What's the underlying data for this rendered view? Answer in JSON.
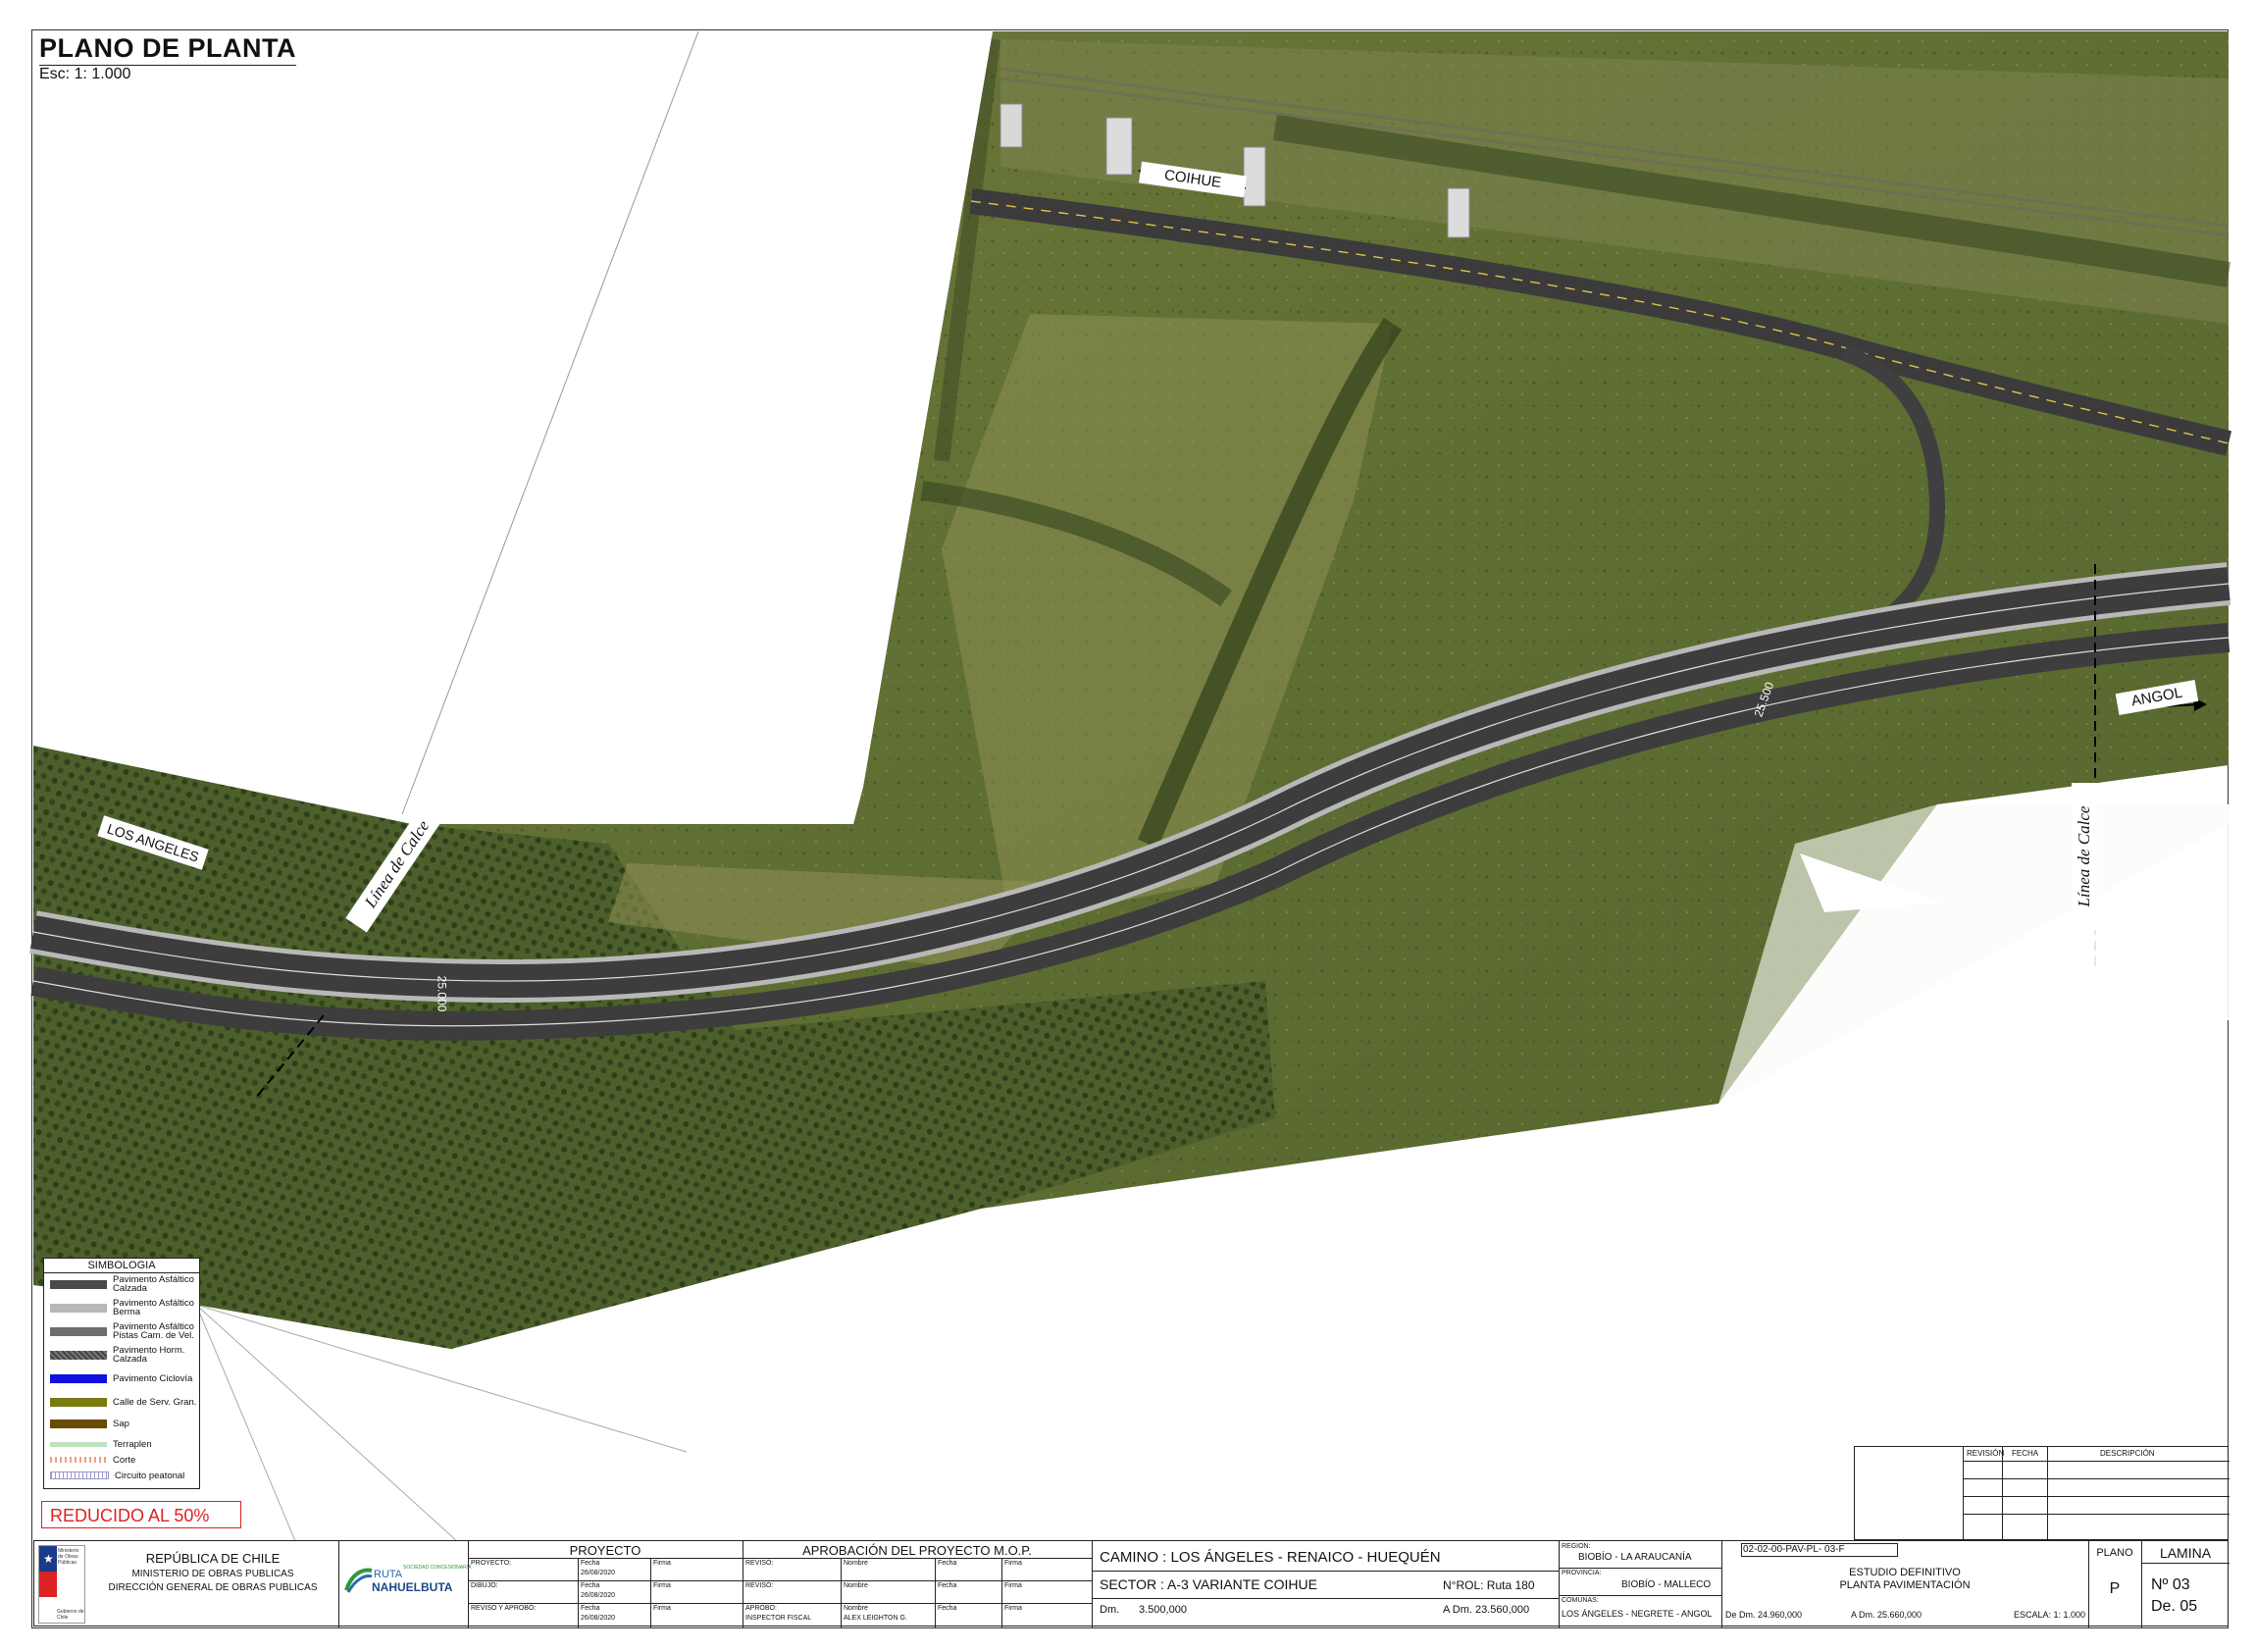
{
  "sheet": {
    "title": "PLANO DE PLANTA",
    "scale": "Esc: 1: 1.000",
    "reduced_note": "REDUCIDO AL 50%"
  },
  "map": {
    "labels": {
      "coihue": "COIHUE",
      "los_angeles": "LOS ANGELES",
      "angol": "ANGOL",
      "linea_calce_left": "Línea de Calce",
      "linea_calce_right": "Línea de Calce",
      "station_top": "25.500",
      "station_bottom": "25.000"
    }
  },
  "legend": {
    "header": "SIMBOLOGIA",
    "items": [
      {
        "label": "Pavimento Asfáltico Calzada",
        "color": "#4a4a4a"
      },
      {
        "label": "Pavimento Asfáltico Berma",
        "color": "#b8b8b8"
      },
      {
        "label": "Pavimento Asfáltico Pistas Cam. de Vel.",
        "color": "#6e6e6e"
      },
      {
        "label": "Pavimento Horm. Calzada",
        "color": "#555555"
      },
      {
        "label": "Pavimento Ciclovía",
        "color": "#1010e0"
      },
      {
        "label": "Calle de Serv. Gran.",
        "color": "#7a7a10"
      },
      {
        "label": "Sap",
        "color": "#6a4a00"
      },
      {
        "label": "Terraplen",
        "color": "#bfe3bf"
      },
      {
        "label": "Corte",
        "color": "#f0b8a0"
      },
      {
        "label": "Circuito peatonal",
        "color": "#c8c8e0"
      }
    ]
  },
  "title_block": {
    "ministry": {
      "line1": "REPÚBLICA DE CHILE",
      "line2": "MINISTERIO DE OBRAS PUBLICAS",
      "line3": "DIRECCIÓN GENERAL DE OBRAS PUBLICAS",
      "logo_text": "Ministerio de Obras Públicas",
      "logo_footer": "Gobierno de Chile"
    },
    "concession": {
      "name1": "RUTA",
      "name2": "NAHUELBUTA",
      "tag": "SOCIEDAD CONCESIONARIA"
    },
    "proyecto": {
      "header": "PROYECTO",
      "rows": [
        {
          "role": "PROYECTO:",
          "fecha_lbl": "Fecha",
          "fecha": "26/08/2020",
          "firma": "Firma"
        },
        {
          "role": "DIBUJO:",
          "fecha_lbl": "Fecha",
          "fecha": "26/08/2020",
          "firma": "Firma"
        },
        {
          "role": "REVISÓ Y APROBÓ:",
          "fecha_lbl": "Fecha",
          "fecha": "26/08/2020",
          "firma": "Firma"
        }
      ]
    },
    "aprobacion": {
      "header": "APROBACIÓN DEL PROYECTO M.O.P.",
      "rows": [
        {
          "role": "REVISÓ:",
          "nombre": "Nombre",
          "fecha": "Fecha",
          "firma": "Firma"
        },
        {
          "role": "REVISÓ:",
          "nombre": "Nombre",
          "fecha": "Fecha",
          "firma": "Firma"
        },
        {
          "role": "APROBÓ:",
          "role2": "INSPECTOR FISCAL",
          "nombre": "Nombre",
          "nombre2": "ALEX LEIGHTON G.",
          "fecha": "Fecha",
          "firma": "Firma"
        }
      ]
    },
    "camino": {
      "title": "CAMINO : LOS ÁNGELES - RENAICO - HUEQUÉN",
      "sector": "SECTOR : A-3 VARIANTE COIHUE",
      "rol": "N°ROL: Ruta 180",
      "dm_label": "Dm.",
      "dm_value": "3.500,000",
      "adm": "A Dm.  23.560,000"
    },
    "location": {
      "region_lbl": "REGION:",
      "region": "BIOBÍO - LA ARAUCANÍA",
      "provincia_lbl": "PROVINCIA:",
      "provincia": "BIOBÍO - MALLECO",
      "comunas_lbl": "COMUNAS:",
      "comunas": "LOS ÁNGELES - NEGRETE - ANGOL"
    },
    "plan": {
      "code": "02-02-00-PAV-PL- 03-F",
      "study": "ESTUDIO DEFINITIVO",
      "sheet_name": "PLANTA PAVIMENTACIÓN",
      "de_dm": "De Dm. 24.960,000",
      "a_dm": "A Dm.  25.660,000",
      "escala": "ESCALA:  1: 1.000",
      "plano_lbl": "PLANO",
      "plano_val": "P",
      "lamina_lbl": "LAMINA",
      "lamina_no": "Nº   03",
      "lamina_de": "De. 05"
    },
    "revision": {
      "revision": "REVISIÓN",
      "fecha": "FECHA",
      "descripcion": "DESCRIPCIÓN"
    }
  }
}
